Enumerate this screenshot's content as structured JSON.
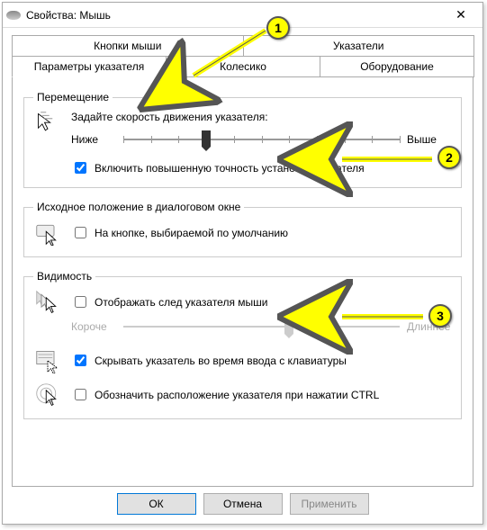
{
  "window": {
    "title": "Свойства: Мышь"
  },
  "tabs": {
    "row1": [
      "Кнопки мыши",
      "Указатели"
    ],
    "row2": [
      "Параметры указателя",
      "Колесико",
      "Оборудование"
    ],
    "active": "Параметры указателя"
  },
  "groups": {
    "motion": {
      "legend": "Перемещение",
      "label": "Задайте скорость движения указателя:",
      "slow": "Ниже",
      "fast": "Выше",
      "slider": {
        "min": 0,
        "max": 10,
        "value": 3
      },
      "precision_cb": {
        "label": "Включить повышенную точность установки указателя",
        "checked": true
      }
    },
    "snapto": {
      "legend": "Исходное положение в диалоговом окне",
      "cb": {
        "label": "На кнопке, выбираемой по умолчанию",
        "checked": false
      }
    },
    "visibility": {
      "legend": "Видимость",
      "trail_cb": {
        "label": "Отображать след указателя мыши",
        "checked": false
      },
      "trail_short": "Короче",
      "trail_long": "Длиннее",
      "trail_slider": {
        "min": 0,
        "max": 10,
        "value": 6,
        "enabled": false
      },
      "hide_cb": {
        "label": "Скрывать указатель во время ввода с клавиатуры",
        "checked": true
      },
      "locate_cb": {
        "label": "Обозначить расположение указателя при нажатии CTRL",
        "checked": false
      }
    }
  },
  "buttons": {
    "ok": "ОК",
    "cancel": "Отмена",
    "apply": "Применить"
  },
  "annotations": {
    "m1": "1",
    "m2": "2",
    "m3": "3"
  }
}
